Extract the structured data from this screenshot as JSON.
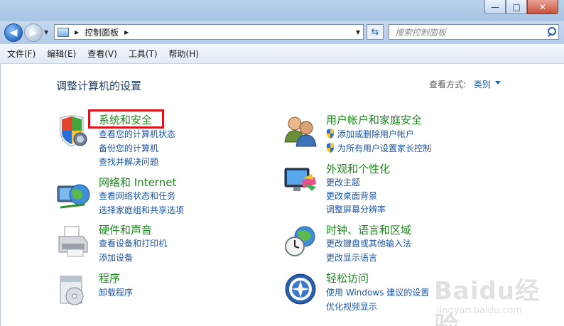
{
  "window": {
    "minimize": "—",
    "maximize": "□",
    "close": "✕"
  },
  "nav": {
    "back_icon": "arrow-left-icon",
    "forward_icon": "arrow-right-icon",
    "address": "控制面板",
    "search_placeholder": "搜索控制面板"
  },
  "menu": [
    "文件(F)",
    "编辑(E)",
    "查看(V)",
    "工具(T)",
    "帮助(H)"
  ],
  "page": {
    "title": "调整计算机的设置",
    "view_label": "查看方式:",
    "view_value": "类别"
  },
  "categories": [
    {
      "title": "系统和安全",
      "icon": "shield-icon",
      "links": [
        "查看您的计算机状态",
        "备份您的计算机",
        "查找并解决问题"
      ]
    },
    {
      "title": "网络和 Internet",
      "icon": "network-globe-icon",
      "links": [
        "查看网络状态和任务",
        "选择家庭组和共享选项"
      ]
    },
    {
      "title": "硬件和声音",
      "icon": "printer-icon",
      "links": [
        "查看设备和打印机",
        "添加设备"
      ]
    },
    {
      "title": "程序",
      "icon": "programs-disc-icon",
      "links": [
        "卸载程序"
      ]
    },
    {
      "title": "用户帐户和家庭安全",
      "icon": "users-icon",
      "links": [
        "添加或删除用户帐户",
        "为所有用户设置家长控制"
      ]
    },
    {
      "title": "外观和个性化",
      "icon": "monitor-palette-icon",
      "links": [
        "更改主题",
        "更改桌面背景",
        "调整屏幕分辨率"
      ]
    },
    {
      "title": "时钟、语言和区域",
      "icon": "clock-globe-icon",
      "links": [
        "更改键盘或其他输入法",
        "更改显示语言"
      ]
    },
    {
      "title": "轻松访问",
      "icon": "ease-of-access-icon",
      "links": [
        "使用 Windows 建议的设置",
        "优化视频显示"
      ]
    }
  ],
  "watermark": {
    "text": "Baidu经验",
    "sub": "jingyan.baidu.com"
  }
}
